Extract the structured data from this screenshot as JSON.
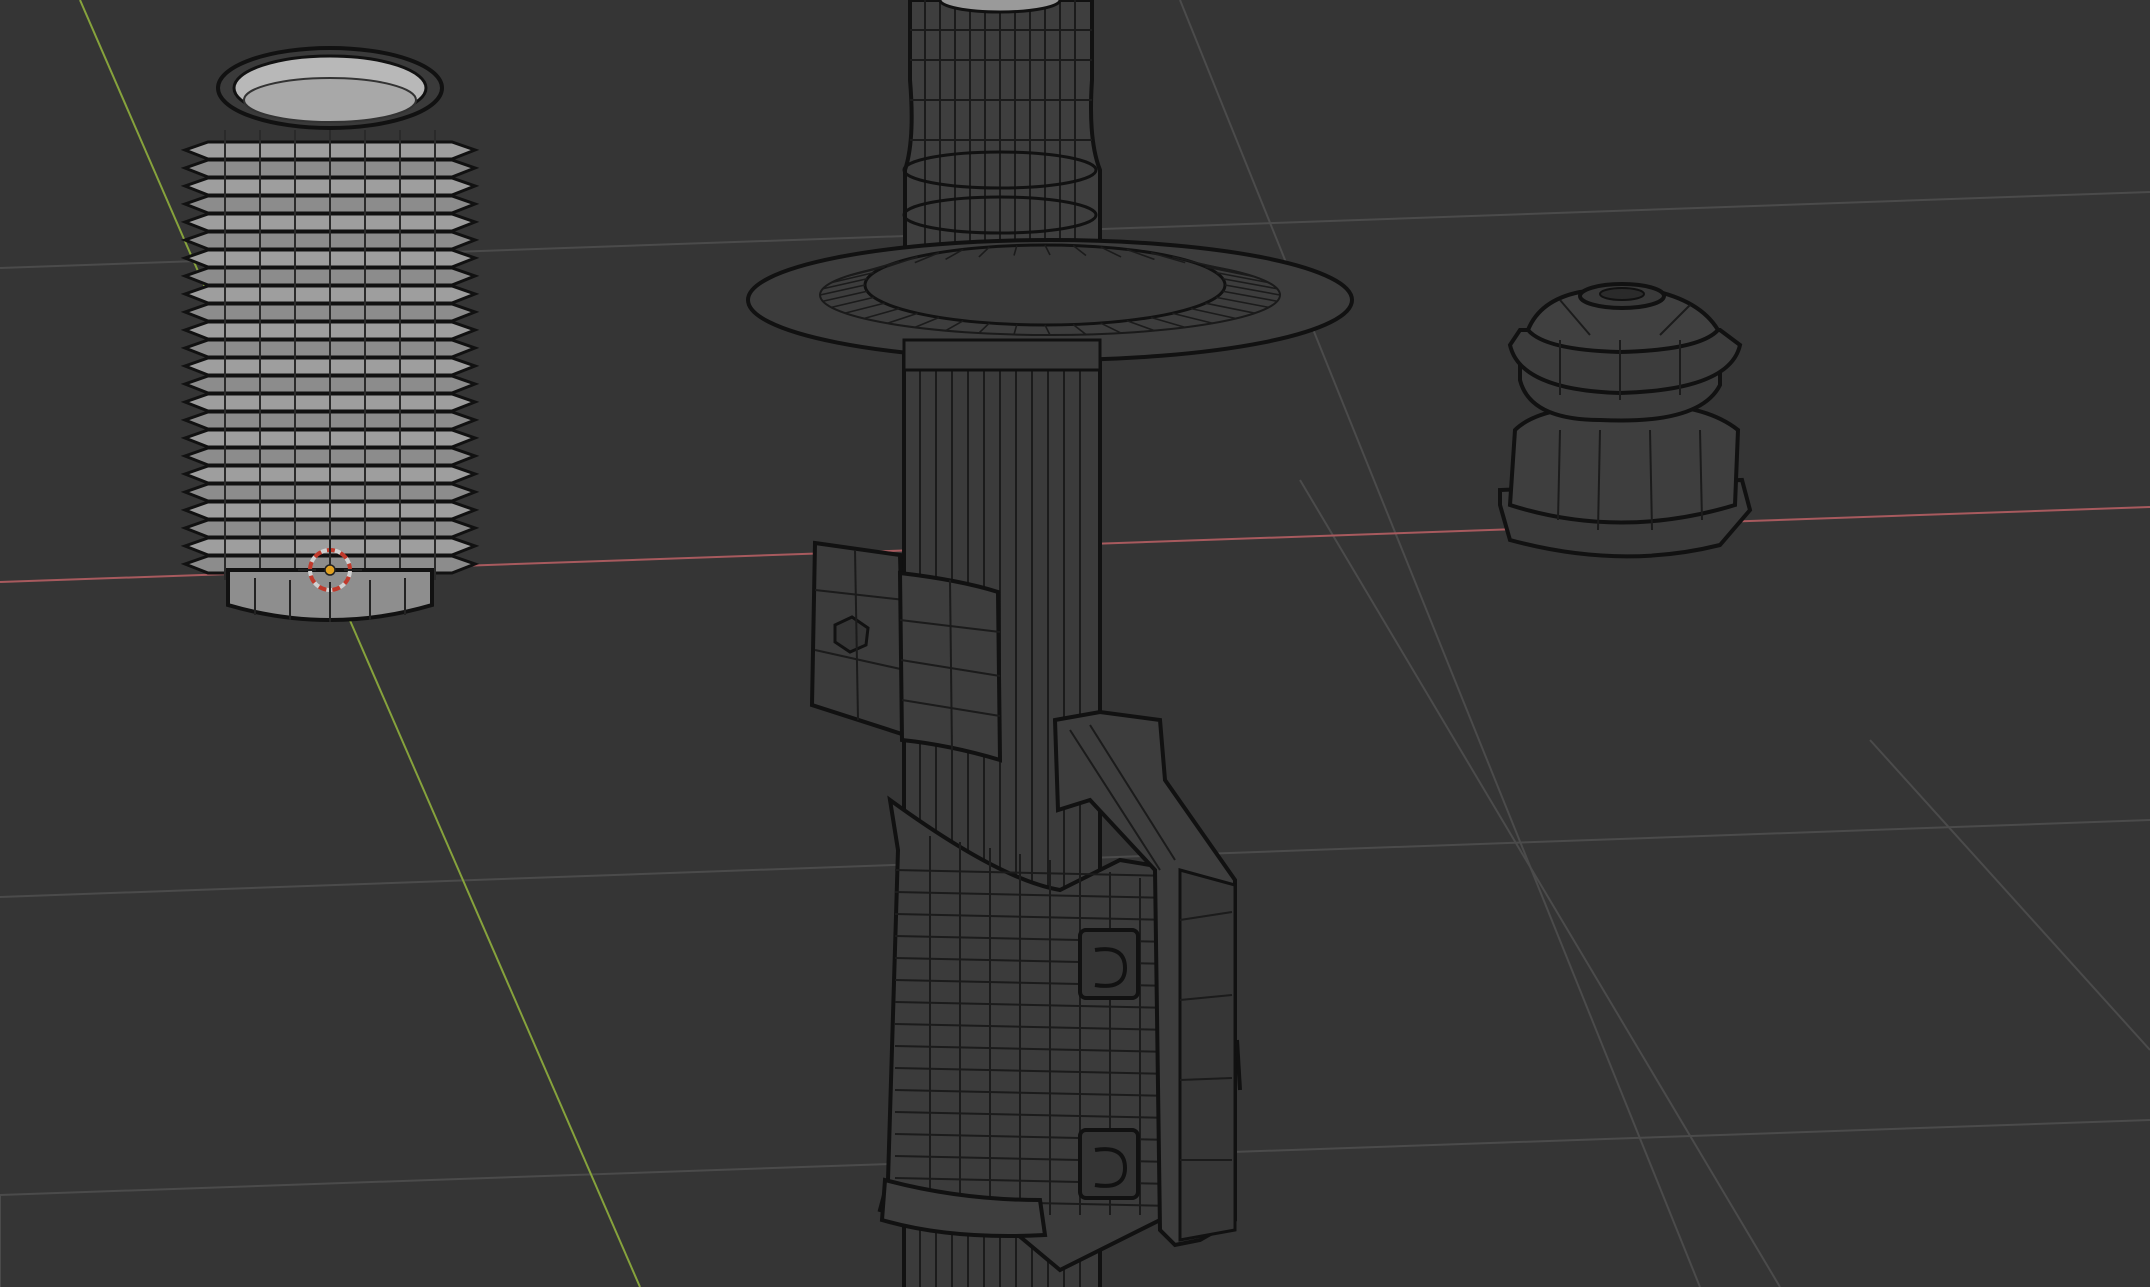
{
  "viewport": {
    "background_color": "#353535",
    "grid_color": "#4a4a4a",
    "x_axis_color": "#a85a5e",
    "y_axis_color": "#86a23c",
    "mesh_fill": "#3c3c3c",
    "mesh_fill_light": "#9a9a9a",
    "wire_color": "#111111",
    "cursor_colors": [
      "#d0d0d0",
      "#c0392b"
    ]
  },
  "scene": {
    "objects": [
      {
        "name": "dust-boot-bellows",
        "icon": "mesh-object"
      },
      {
        "name": "shock-absorber-strut",
        "icon": "mesh-object"
      },
      {
        "name": "bump-stop",
        "icon": "mesh-object"
      }
    ],
    "cursor": {
      "icon": "3d-cursor-icon"
    }
  }
}
